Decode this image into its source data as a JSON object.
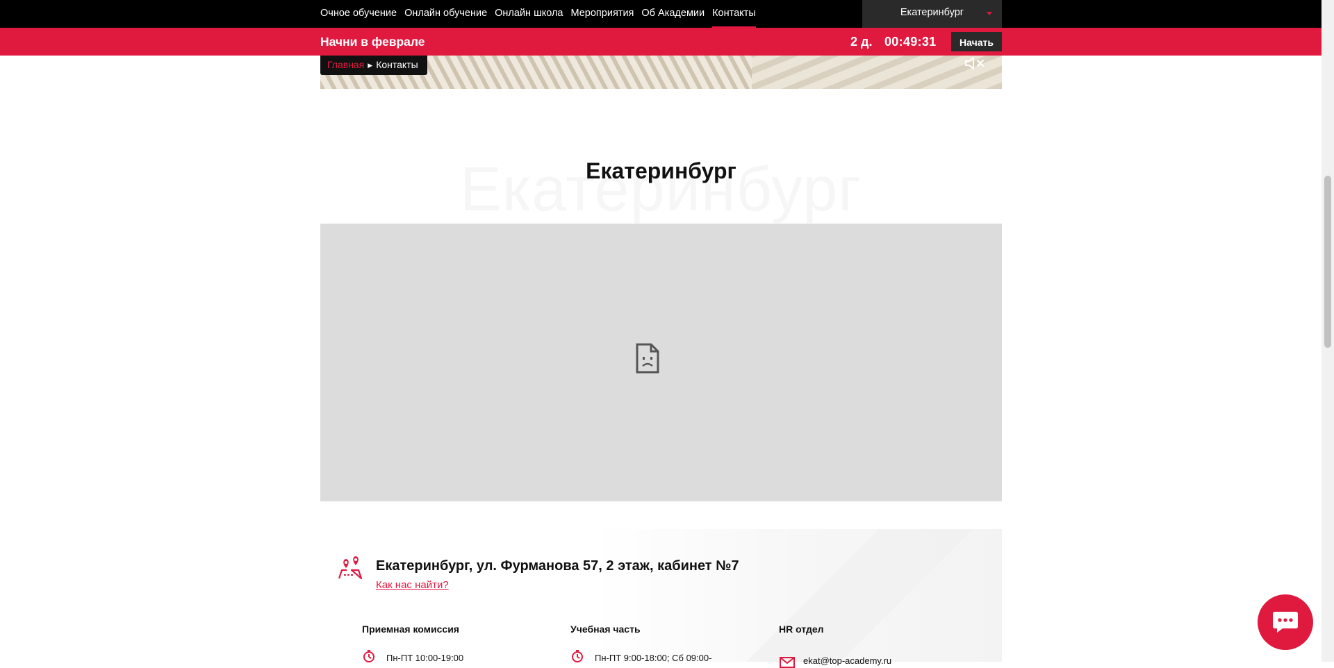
{
  "nav": {
    "items": [
      {
        "label": "Очное обучение"
      },
      {
        "label": "Онлайн обучение"
      },
      {
        "label": "Онлайн школа"
      },
      {
        "label": "Мероприятия"
      },
      {
        "label": "Об Академии"
      },
      {
        "label": "Контакты"
      }
    ],
    "active_item": "Контакты",
    "city_selected": "Екатеринбург"
  },
  "promo": {
    "title": "Начни в феврале",
    "days": "2 д.",
    "time": "00:49:31",
    "button_label": "Начать"
  },
  "breadcrumb": {
    "home": "Главная",
    "current": "Контакты"
  },
  "hero": {
    "mute_icon": "volume-mute-icon"
  },
  "city": {
    "title": "Екатеринбург",
    "background_text": "Екатеринбург"
  },
  "map": {
    "state": "broken-file-icon"
  },
  "contact": {
    "address": "Екатеринбург, ул. Фурманова 57, 2 этаж, кабинет №7",
    "directions_link": "Как нас найти?",
    "departments": [
      {
        "title": "Приемная комиссия",
        "hours": "Пн-ПТ 10:00-19:00"
      },
      {
        "title": "Учебная часть",
        "hours": "Пн-ПТ 9:00-18:00; Сб 09:00-"
      },
      {
        "title": "HR отдел",
        "email": "ekat@top-academy.ru"
      }
    ]
  },
  "colors": {
    "accent": "#e0193f",
    "topbar": "#000000",
    "dark_button": "#2a2a2a",
    "map_placeholder": "#dcdcdc"
  }
}
